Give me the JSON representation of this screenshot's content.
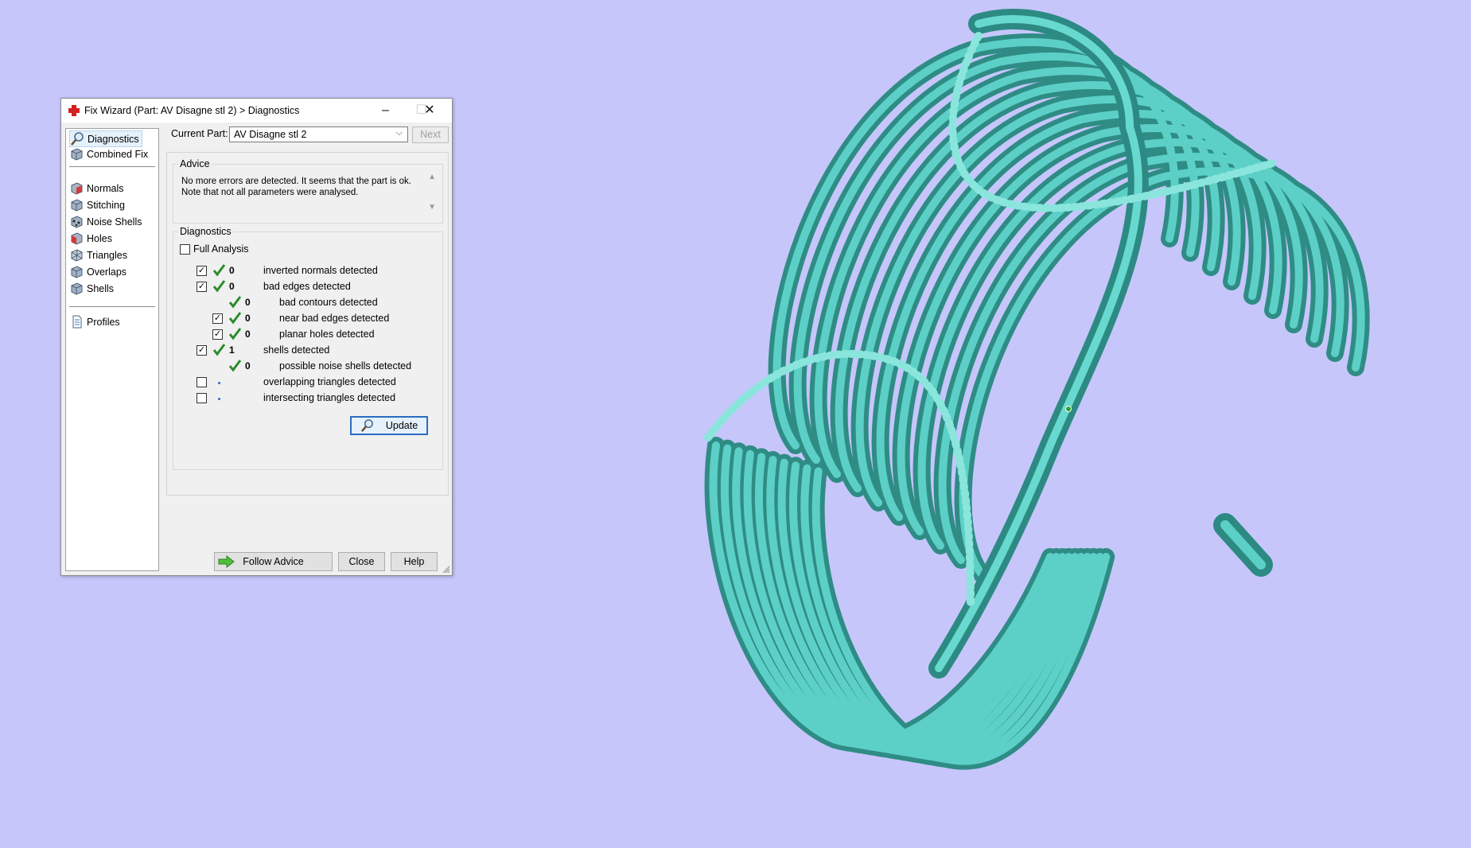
{
  "window": {
    "title": "Fix Wizard (Part: AV Disagne stl 2) > Diagnostics",
    "minimize_glyph": "–",
    "maximize_glyph": "☐",
    "close_glyph": "✕"
  },
  "sidebar": {
    "items": [
      {
        "label": "Diagnostics",
        "icon": "magnifier-icon",
        "selected": true
      },
      {
        "label": "Combined Fix",
        "icon": "cube-icon"
      },
      {
        "label": "Normals",
        "icon": "cube-red-icon"
      },
      {
        "label": "Stitching",
        "icon": "cube-icon"
      },
      {
        "label": "Noise Shells",
        "icon": "cube-dots-icon"
      },
      {
        "label": "Holes",
        "icon": "cube-red-icon"
      },
      {
        "label": "Triangles",
        "icon": "cube-wire-icon"
      },
      {
        "label": "Overlaps",
        "icon": "cube-icon"
      },
      {
        "label": "Shells",
        "icon": "cube-icon"
      },
      {
        "label": "Profiles",
        "icon": "document-icon"
      }
    ]
  },
  "current_part": {
    "label": "Current Part:",
    "value": "AV Disagne stl 2",
    "next_label": "Next"
  },
  "advice": {
    "title": "Advice",
    "line1": "No more errors are detected. It seems that the part is ok.",
    "line2": "Note that not all parameters were analysed."
  },
  "diagnostics": {
    "title": "Diagnostics",
    "full_analysis_label": "Full Analysis",
    "full_analysis_checked": false,
    "rows": [
      {
        "checkbox": true,
        "checked": true,
        "status": "ok",
        "count": "0",
        "label": "inverted normals detected",
        "indent": 0
      },
      {
        "checkbox": true,
        "checked": true,
        "status": "ok",
        "count": "0",
        "label": "bad edges detected",
        "indent": 0
      },
      {
        "checkbox": false,
        "checked": false,
        "status": "ok",
        "count": "0",
        "label": "bad contours detected",
        "indent": 1
      },
      {
        "checkbox": true,
        "checked": true,
        "status": "ok",
        "count": "0",
        "label": "near bad edges detected",
        "indent": 1
      },
      {
        "checkbox": true,
        "checked": true,
        "status": "ok",
        "count": "0",
        "label": "planar holes detected",
        "indent": 1
      },
      {
        "checkbox": true,
        "checked": true,
        "status": "ok",
        "count": "1",
        "label": "shells detected",
        "indent": 0
      },
      {
        "checkbox": false,
        "checked": false,
        "status": "ok",
        "count": "0",
        "label": "possible noise shells detected",
        "indent": 1
      },
      {
        "checkbox": true,
        "checked": false,
        "status": "none",
        "count": "",
        "label": "overlapping triangles detected",
        "indent": 0
      },
      {
        "checkbox": true,
        "checked": false,
        "status": "none",
        "count": "",
        "label": "intersecting triangles detected",
        "indent": 0
      }
    ],
    "update_label": "Update"
  },
  "buttons": {
    "follow_advice": "Follow Advice",
    "close": "Close",
    "help": "Help"
  },
  "colors": {
    "background": "#c6c6fb",
    "model": "#3fb0a6",
    "check_green": "#2e8b2e"
  }
}
